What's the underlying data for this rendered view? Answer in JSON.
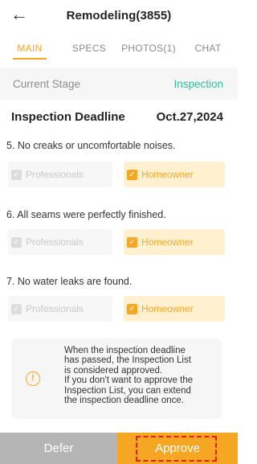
{
  "header": {
    "title": "Remodeling(3855)",
    "back_icon": "arrow-left-icon"
  },
  "tabs": [
    {
      "label": "MAIN",
      "active": true
    },
    {
      "label": "SPECS",
      "active": false
    },
    {
      "label": "PHOTOS(1)",
      "active": false
    },
    {
      "label": "CHAT",
      "active": false
    }
  ],
  "stage": {
    "label": "Current Stage",
    "value": "Inspection"
  },
  "deadline": {
    "label": "Inspection Deadline",
    "value": "Oct.27,2024"
  },
  "items": [
    {
      "text": "5. No creaks or uncomfortable noises.",
      "professionals": "Professionals",
      "homeowner": "Homeowner",
      "professionals_checked": true,
      "homeowner_checked": true
    },
    {
      "text": "6. All seams were perfectly finished.",
      "professionals": "Professionals",
      "homeowner": "Homeowner",
      "professionals_checked": true,
      "homeowner_checked": true
    },
    {
      "text": "7. No water leaks are found.",
      "professionals": "Professionals",
      "homeowner": "Homeowner",
      "professionals_checked": true,
      "homeowner_checked": true
    }
  ],
  "notice": {
    "icon": "info-icon",
    "text": "When the inspection deadline\nhas passed, the Inspection List\nis considered approved.\nIf you don't want to approve the\nInspection List, you can extend\nthe inspection deadline once."
  },
  "footer": {
    "defer_label": "Defer",
    "approve_label": "Approve"
  },
  "colors": {
    "accent": "#f5a623",
    "stage": "#2bbf9c",
    "defer_bg": "#b5b5b5",
    "highlight": "#e02020"
  }
}
